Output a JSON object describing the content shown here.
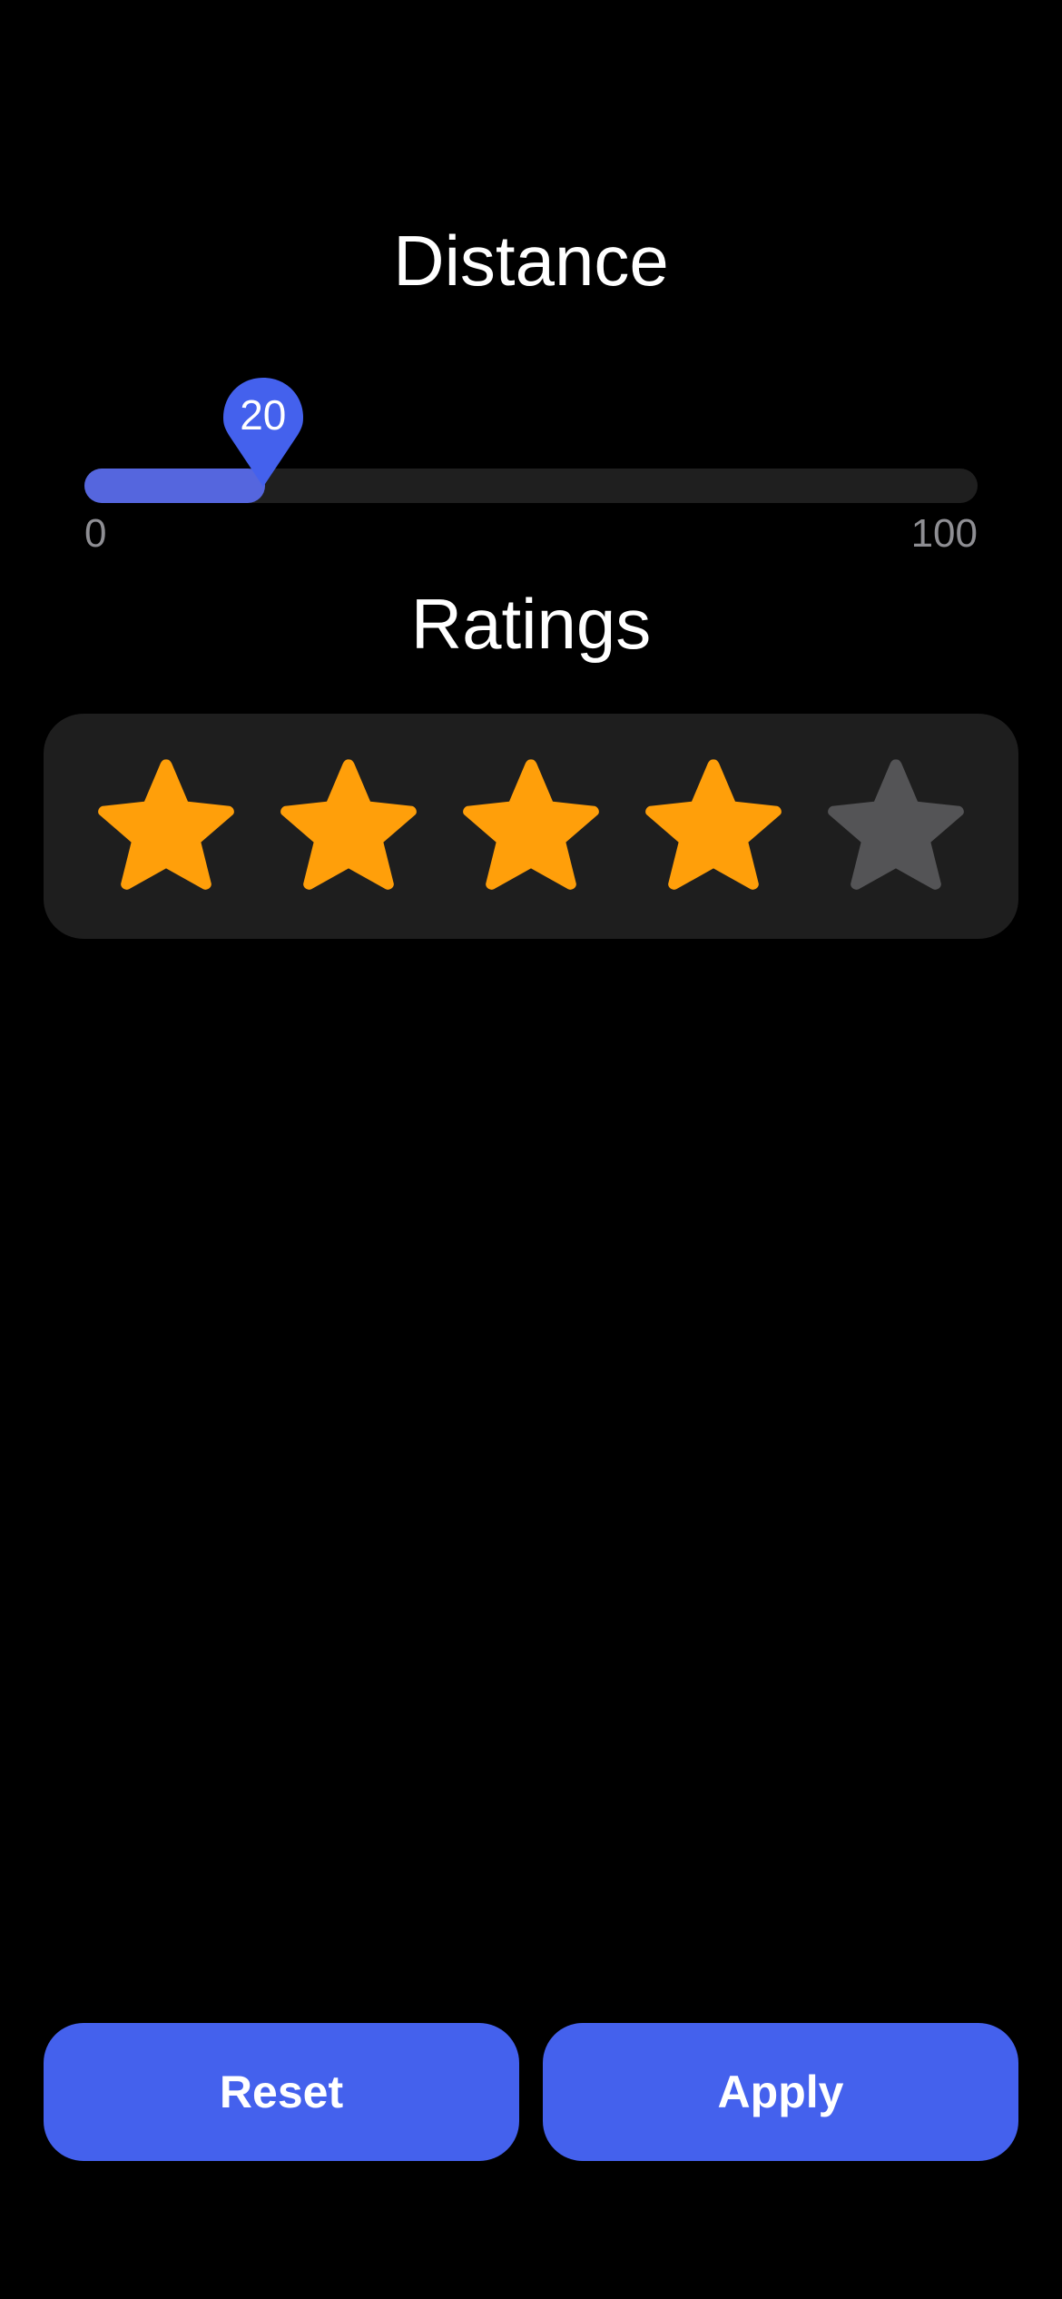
{
  "distance": {
    "title": "Distance",
    "min_label": "0",
    "max_label": "100",
    "min": 0,
    "max": 100,
    "value": 20,
    "value_label": "20",
    "fill_color": "#5566de",
    "thumb_color": "#4461ed",
    "track_color": "#1f1f1f"
  },
  "ratings": {
    "title": "Ratings",
    "selected": 4,
    "total": 5,
    "active_color": "#ff9f0a",
    "inactive_color": "#545456"
  },
  "actions": {
    "reset_label": "Reset",
    "apply_label": "Apply",
    "button_color": "#4461ed"
  }
}
